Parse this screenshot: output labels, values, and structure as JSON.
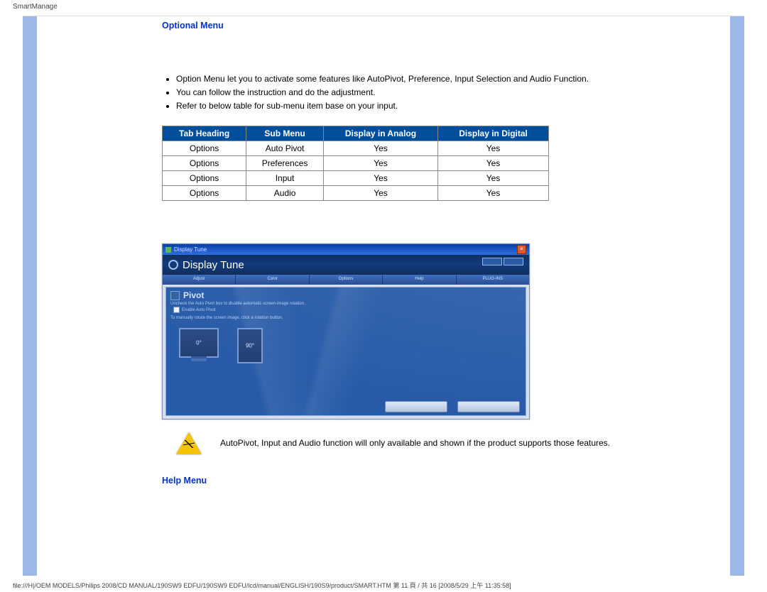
{
  "page": {
    "title": "SmartManage"
  },
  "section": {
    "optional_title": "Optional Menu",
    "bullets": [
      "Option Menu let you to activate some features like AutoPivot, Preference, Input Selection and Audio Function.",
      "You can follow the instruction and do the adjustment.",
      "Refer to below table for sub-menu item base on your input."
    ]
  },
  "table": {
    "headers": [
      "Tab Heading",
      "Sub Menu",
      "Display in Analog",
      "Display in Digital"
    ],
    "rows": [
      [
        "Options",
        "Auto Pivot",
        "Yes",
        "Yes"
      ],
      [
        "Options",
        "Preferences",
        "Yes",
        "Yes"
      ],
      [
        "Options",
        "Input",
        "Yes",
        "Yes"
      ],
      [
        "Options",
        "Audio",
        "Yes",
        "Yes"
      ]
    ]
  },
  "app": {
    "window_title": "Display Tune",
    "banner_title": "Display Tune",
    "tabs": [
      "Adjust",
      "Color",
      "Options",
      "Help",
      "PLUG-INS"
    ],
    "pane_title": "Pivot",
    "pane_note1": "Uncheck the Auto Pivot box to disable automatic screen-image rotation.",
    "checkbox_label": "Enable Auto Pivot",
    "pane_note2": "To manually rotate the screen image, click a rotation button.",
    "deg0": "0°",
    "deg90": "90°"
  },
  "note": {
    "text": "AutoPivot, Input and Audio function will only available and shown if the product supports those features."
  },
  "help": {
    "title": "Help Menu"
  },
  "footer": {
    "path": "file:///H|/OEM MODELS/Philips 2008/CD MANUAL/190SW9 EDFU/190SW9 EDFU/lcd/manual/ENGLISH/190S9/product/SMART.HTM 第 11 頁 / 共 16  [2008/5/29 上午 11:35:58]"
  }
}
